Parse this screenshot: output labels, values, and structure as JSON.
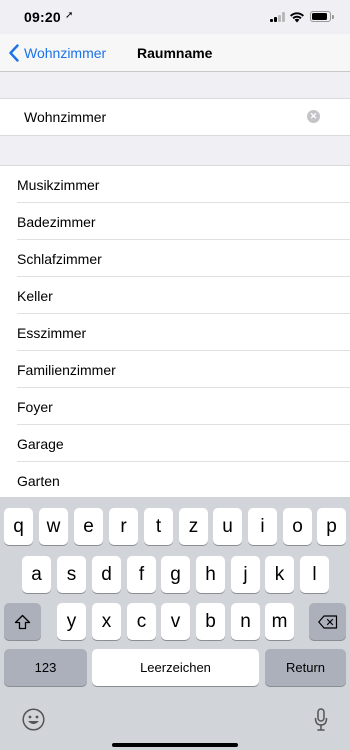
{
  "status_bar": {
    "time": "09:20",
    "location_arrow": "➚"
  },
  "nav": {
    "back_label": "Wohnzimmer",
    "title": "Raumname"
  },
  "input": {
    "value": "Wohnzimmer",
    "clear_glyph": "✕"
  },
  "suggestions": [
    "Musikzimmer",
    "Badezimmer",
    "Schlafzimmer",
    "Keller",
    "Esszimmer",
    "Familienzimmer",
    "Foyer",
    "Garage",
    "Garten"
  ],
  "keyboard": {
    "row1": [
      "q",
      "w",
      "e",
      "r",
      "t",
      "z",
      "u",
      "i",
      "o",
      "p"
    ],
    "row2": [
      "a",
      "s",
      "d",
      "f",
      "g",
      "h",
      "j",
      "k",
      "l"
    ],
    "row3": [
      "y",
      "x",
      "c",
      "v",
      "b",
      "n",
      "m"
    ],
    "numbers_label": "123",
    "space_label": "Leerzeichen",
    "return_label": "Return"
  },
  "colors": {
    "accent": "#1a73e8",
    "background": "#efeff4",
    "keyboard": "#d1d4d9"
  }
}
